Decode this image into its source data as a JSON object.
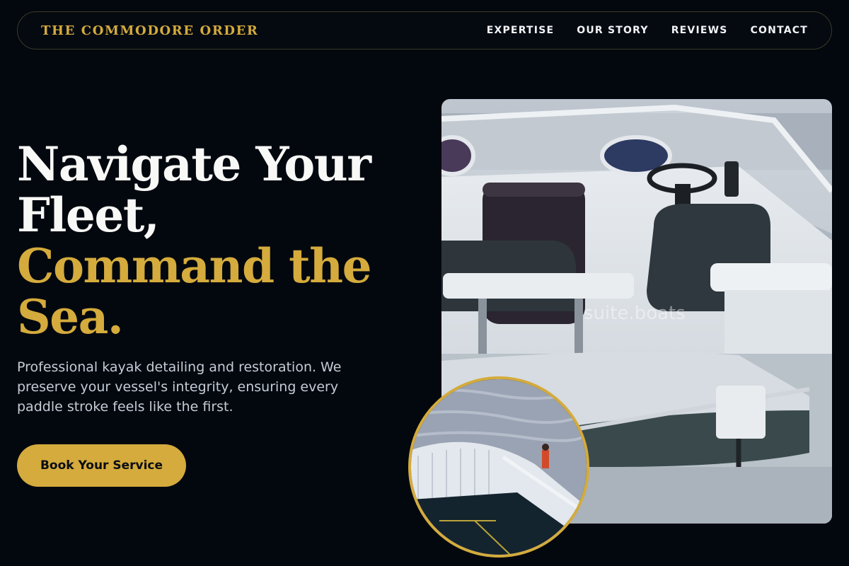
{
  "brand": "THE COMMODORE ORDER",
  "nav": {
    "items": [
      {
        "label": "EXPERTISE"
      },
      {
        "label": "OUR STORY"
      },
      {
        "label": "REVIEWS"
      },
      {
        "label": "CONTACT"
      }
    ]
  },
  "hero": {
    "headline_line1": "Navigate Your",
    "headline_line2": "Fleet,",
    "headline_line3": "Command the",
    "headline_line4": "Sea.",
    "description": "Professional kayak detailing and restoration. We preserve your vessel's integrity, ensuring every paddle stroke feels like the first.",
    "cta_label": "Book Your Service"
  },
  "media": {
    "main_watermark": "suite.boats",
    "main_image": "boat-cockpit-photo",
    "inset_image": "ship-deck-photo"
  },
  "colors": {
    "background": "#03080f",
    "accent": "#d4ab3c",
    "text": "#f8f8f6"
  }
}
